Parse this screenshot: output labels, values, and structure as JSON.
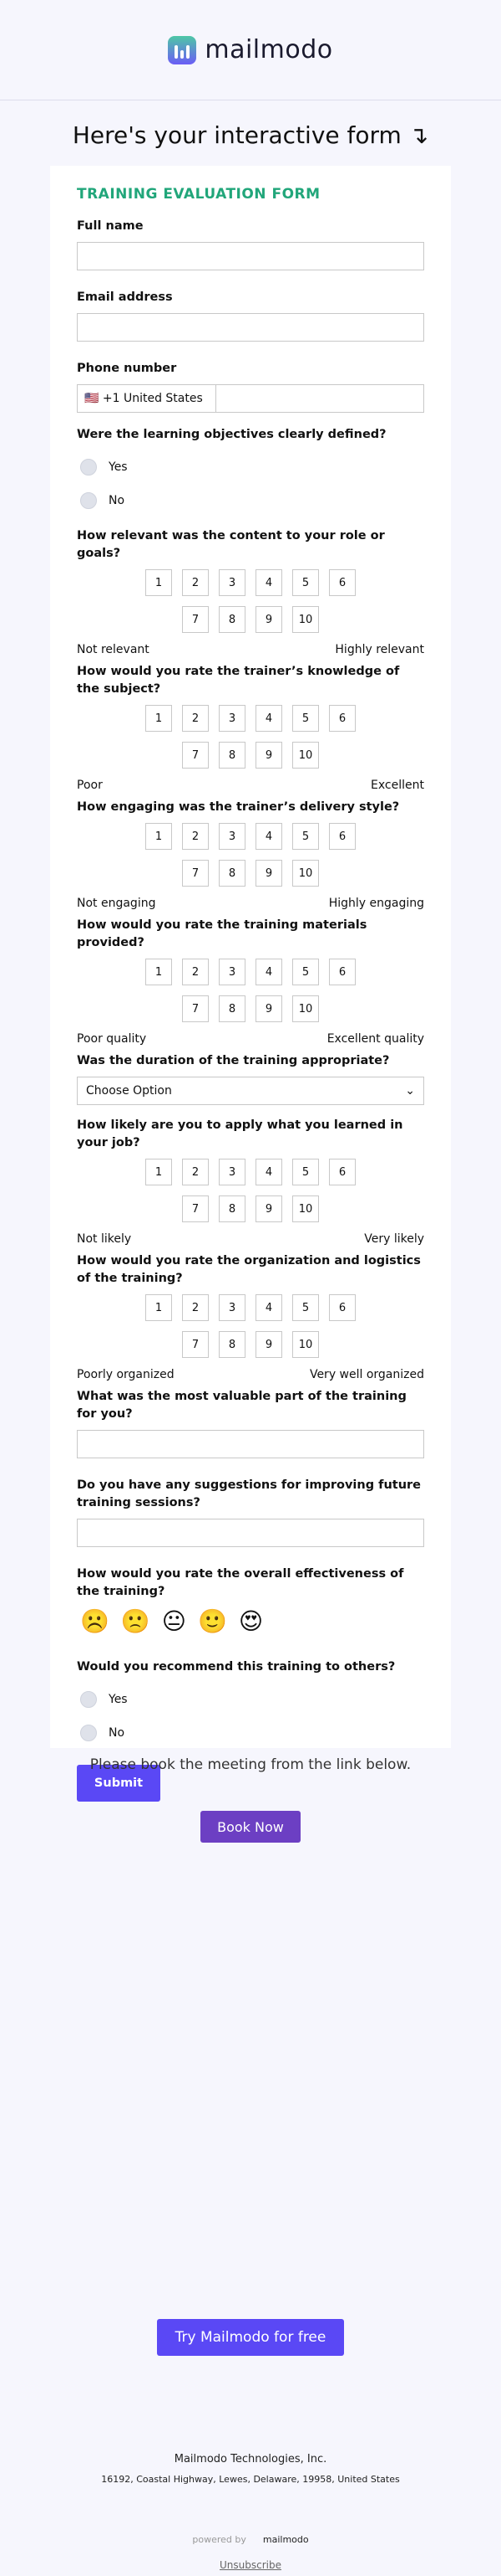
{
  "brand": {
    "name": "mailmodo"
  },
  "heading": "Here's your interactive form ↴",
  "form": {
    "title": "TRAINING EVALUATION FORM",
    "full_name_label": "Full name",
    "email_label": "Email address",
    "phone_label": "Phone number",
    "phone_country": "🇺🇸 +1 United States",
    "q_objectives": "Were the learning objectives clearly defined?",
    "yes": "Yes",
    "no": "No",
    "q_relevant": "How relevant was the content to your role or goals?",
    "relevant_low": "Not relevant",
    "relevant_high": "Highly relevant",
    "q_knowledge": "How would you rate the trainer’s knowledge of the subject?",
    "knowledge_low": "Poor",
    "knowledge_high": "Excellent",
    "q_engaging": "How engaging was the trainer’s delivery style?",
    "engaging_low": "Not engaging",
    "engaging_high": "Highly engaging",
    "q_materials": "How would you rate the training materials provided?",
    "materials_low": "Poor quality",
    "materials_high": "Excellent quality",
    "q_duration": "Was the duration of the training appropriate?",
    "select_placeholder": "Choose Option",
    "q_apply": "How likely are you to apply what you learned in your job?",
    "apply_low": "Not likely",
    "apply_high": "Very likely",
    "q_organization": "How would you rate the organization and logistics of the training?",
    "organization_low": "Poorly organized",
    "organization_high": "Very well organized",
    "q_valuable": "What was the most valuable part of the training for you?",
    "q_suggestions": "Do you have any suggestions for improving future training sessions?",
    "q_effectiveness": "How would you rate the overall effectiveness of the training?",
    "emojis": [
      "☹️",
      "🙁",
      "😐",
      "🙂",
      "😍"
    ],
    "q_recommend": "Would you recommend this training to others?",
    "submit": "Submit"
  },
  "scale_values": [
    "1",
    "2",
    "3",
    "4",
    "5",
    "6",
    "7",
    "8",
    "9",
    "10"
  ],
  "note": "Please book the meeting from the link below.",
  "book_button": "Book Now",
  "try_button": "Try Mailmodo for free",
  "footer": {
    "company": "Mailmodo Technologies, Inc.",
    "address": "16192, Coastal Highway, Lewes, Delaware, 19958, United States",
    "powered_by": "powered by",
    "powered_brand": "mailmodo",
    "unsubscribe": "Unsubscribe"
  }
}
